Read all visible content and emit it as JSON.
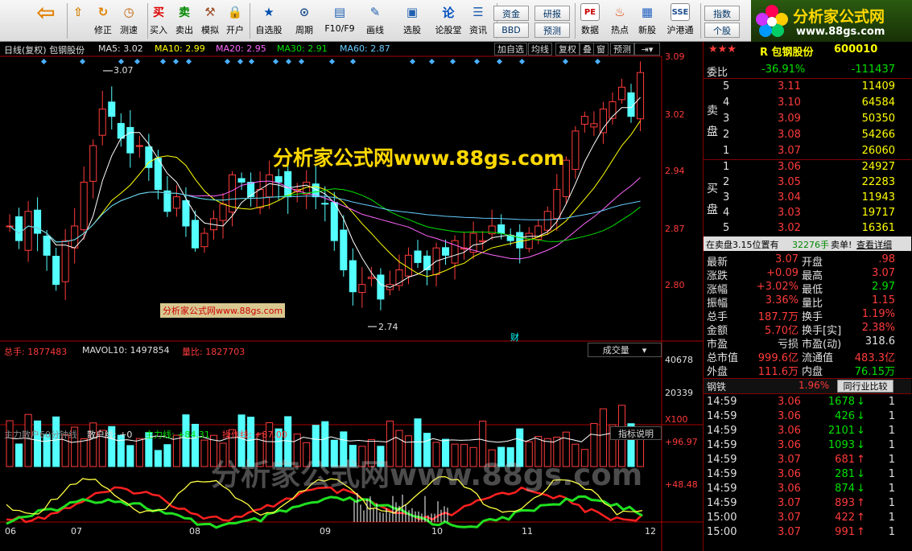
{
  "toolbar": {
    "items": [
      {
        "label": "",
        "icon": "back-arrow-icon",
        "glyph": "⇦"
      },
      {
        "label": "",
        "icon": "up-down-arrow-icon",
        "glyph": "⇧"
      },
      {
        "label": "修正",
        "icon": "refresh-icon",
        "glyph": "↻"
      },
      {
        "label": "测速",
        "icon": "clock-icon",
        "glyph": "◷"
      },
      {
        "label": "买入",
        "icon": "buy-icon",
        "glyph": "买"
      },
      {
        "label": "卖出",
        "icon": "sell-icon",
        "glyph": "卖"
      },
      {
        "label": "模拟",
        "icon": "hammer-icon",
        "glyph": "⚒"
      },
      {
        "label": "开户",
        "icon": "lock-icon",
        "glyph": "🔒"
      },
      {
        "label": "自选股",
        "icon": "watchlist-icon",
        "glyph": "★"
      },
      {
        "label": "周期",
        "icon": "period-icon",
        "glyph": "⊙"
      },
      {
        "label": "F10/F9",
        "icon": "f10-icon",
        "glyph": "▤"
      },
      {
        "label": "画线",
        "icon": "pen-icon",
        "glyph": "✎"
      },
      {
        "label": "选股",
        "icon": "stock-pick-icon",
        "glyph": "▣"
      },
      {
        "label": "论股堂",
        "icon": "forum-icon",
        "glyph": "论"
      },
      {
        "label": "资讯",
        "icon": "news-icon",
        "glyph": "☰"
      },
      {
        "label": "数据",
        "icon": "data-icon",
        "glyph": "PE"
      },
      {
        "label": "热点",
        "icon": "hotspot-icon",
        "glyph": "♨"
      },
      {
        "label": "新股",
        "icon": "new-stock-icon",
        "glyph": "▦"
      },
      {
        "label": "沪港通",
        "icon": "hk-connect-icon",
        "glyph": "SSE"
      }
    ],
    "mini": [
      "资金",
      "研报",
      "指数",
      "BBD",
      "预测",
      "个股"
    ]
  },
  "logo": {
    "title": "分析家公式网",
    "url": "www.88gs.com"
  },
  "kline": {
    "header": "日线(复权)  包钢股份",
    "ma5": "MA5: 3.02",
    "ma10": "MA10: 2.99",
    "ma20": "MA20: 2.95",
    "ma30": "MA30: 2.91",
    "ma60": "MA60: 2.87",
    "buttons": [
      "加自选",
      "均线",
      "复权",
      "叠",
      "窗",
      "预测"
    ],
    "yticks": [
      "3.09",
      "3.02",
      "2.94",
      "2.87",
      "2.80"
    ],
    "high_mark": "3.07",
    "low_mark": "2.74",
    "watermark": "分析家公式网www.88gs.com",
    "small_watermark": "分析家公式网www.88gs.com",
    "cai": "财"
  },
  "volume": {
    "zongshou": "总手: 1877483",
    "mavol": "MAVOL10: 1497854",
    "liangbi": "量比: 1827703",
    "selector": "成交量",
    "yticks": [
      "40678",
      "20339",
      "X100"
    ]
  },
  "indicator": {
    "title": "主力散户60分钟线",
    "sanhu": "散户线: +0",
    "zhuli": "主力线: +84.31",
    "caozuo": "操作线: +87.00",
    "button": "指标说明",
    "yticks": [
      "+96.97",
      "+48.48"
    ],
    "watermark": "分析家公式网www.88gs.com"
  },
  "xaxis": [
    "06",
    "07",
    "08",
    "09",
    "10",
    "11",
    "12"
  ],
  "quote": {
    "stars": "★★★",
    "name": "R 包钢股份",
    "code": "600010",
    "weibi_label": "委比",
    "weibi": "-36.91%",
    "weicha": "-111437",
    "sell_label": "卖盘",
    "buy_label": "买盘",
    "asks": [
      {
        "lv": "5",
        "p": "3.11",
        "v": "11409"
      },
      {
        "lv": "4",
        "p": "3.10",
        "v": "64584"
      },
      {
        "lv": "3",
        "p": "3.09",
        "v": "50350"
      },
      {
        "lv": "2",
        "p": "3.08",
        "v": "54266"
      },
      {
        "lv": "1",
        "p": "3.07",
        "v": "26060"
      }
    ],
    "bids": [
      {
        "lv": "1",
        "p": "3.06",
        "v": "24927"
      },
      {
        "lv": "2",
        "p": "3.05",
        "v": "22283"
      },
      {
        "lv": "3",
        "p": "3.04",
        "v": "11943"
      },
      {
        "lv": "4",
        "p": "3.03",
        "v": "19717"
      },
      {
        "lv": "5",
        "p": "3.02",
        "v": "16361"
      }
    ],
    "notice": "在卖盘3.15位置有",
    "notice_vol": "32276手",
    "notice_tail": "卖单!",
    "notice_btn": "查看详细",
    "stats": [
      {
        "l1": "最新",
        "v1": "3.07",
        "l2": "开盘",
        "v2": ".98"
      },
      {
        "l1": "涨跌",
        "v1": "+0.09",
        "l2": "最高",
        "v2": "3.07"
      },
      {
        "l1": "涨幅",
        "v1": "+3.02%",
        "l2": "最低",
        "v2": "2.97"
      },
      {
        "l1": "振幅",
        "v1": "3.36%",
        "l2": "量比",
        "v2": "1.15"
      },
      {
        "l1": "总手",
        "v1": "187.7万",
        "l2": "换手",
        "v2": "1.19%"
      },
      {
        "l1": "金额",
        "v1": "5.70亿",
        "l2": "换手[实]",
        "v2": "2.38%"
      },
      {
        "l1": "市盈",
        "v1": "亏损",
        "l2": "市盈(动)",
        "v2": "318.6"
      },
      {
        "l1": "总市值",
        "v1": "999.6亿",
        "l2": "流通值",
        "v2": "483.3亿"
      },
      {
        "l1": "外盘",
        "v1": "111.6万",
        "l2": "内盘",
        "v2": "76.15万"
      }
    ],
    "industry": "钢铁",
    "industry_pct": "1.96%",
    "industry_btn": "同行业比较",
    "ticks": [
      {
        "t": "14:59",
        "p": "3.06",
        "v": "1678",
        "d": "down"
      },
      {
        "t": "14:59",
        "p": "3.06",
        "v": "426",
        "d": "down"
      },
      {
        "t": "14:59",
        "p": "3.06",
        "v": "2101",
        "d": "down"
      },
      {
        "t": "14:59",
        "p": "3.06",
        "v": "1093",
        "d": "down"
      },
      {
        "t": "14:59",
        "p": "3.07",
        "v": "681",
        "d": "up"
      },
      {
        "t": "14:59",
        "p": "3.06",
        "v": "281",
        "d": "down"
      },
      {
        "t": "14:59",
        "p": "3.06",
        "v": "874",
        "d": "down"
      },
      {
        "t": "14:59",
        "p": "3.07",
        "v": "893",
        "d": "up"
      },
      {
        "t": "15:00",
        "p": "3.07",
        "v": "422",
        "d": "up"
      },
      {
        "t": "15:00",
        "p": "3.07",
        "v": "991",
        "d": "up"
      }
    ],
    "tick_tail": "1"
  },
  "chart_data": {
    "type": "candlestick",
    "categories": [
      "06",
      "07",
      "08",
      "09",
      "10",
      "11",
      "12"
    ],
    "yticks": [
      3.09,
      3.02,
      2.94,
      2.87,
      2.8
    ],
    "high_label": 3.07,
    "low_label": 2.74,
    "close": [
      2.86,
      2.84,
      2.88,
      2.85,
      2.82,
      2.78,
      2.84,
      2.86,
      2.92,
      2.97,
      3.02,
      3.01,
      2.98,
      2.96,
      2.97,
      2.94,
      2.91,
      2.88,
      2.9,
      2.86,
      2.83,
      2.85,
      2.87,
      2.89,
      2.93,
      2.92,
      2.9,
      2.91,
      2.93,
      2.92,
      2.9,
      2.91,
      2.92,
      2.9,
      2.89,
      2.84,
      2.8,
      2.77,
      2.78,
      2.79,
      2.76,
      2.78,
      2.8,
      2.82,
      2.81,
      2.8,
      2.83,
      2.82,
      2.84,
      2.83,
      2.85,
      2.84,
      2.86,
      2.85,
      2.84,
      2.83,
      2.85,
      2.86,
      2.88,
      2.91,
      2.95,
      2.99,
      3.01,
      3.0,
      3.02,
      3.03,
      3.05,
      3.01,
      3.07
    ],
    "ma20_end": 2.95,
    "ma60_end": 2.87
  }
}
